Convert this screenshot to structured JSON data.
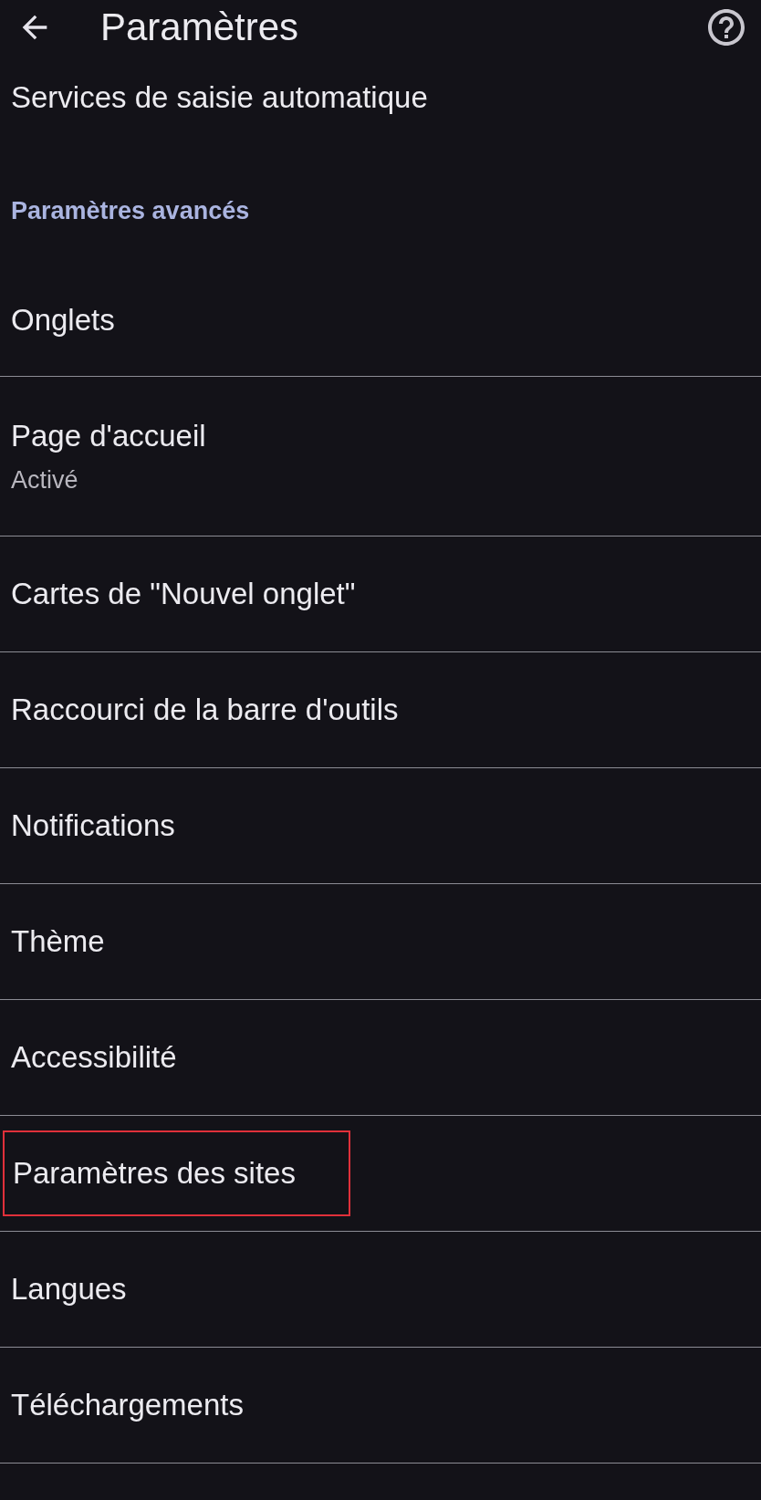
{
  "header": {
    "title": "Paramètres"
  },
  "top_item": {
    "label": "Services de saisie automatique"
  },
  "section": {
    "title": "Paramètres avancés"
  },
  "items": [
    {
      "label": "Onglets",
      "highlighted": false
    },
    {
      "label": "Page d'accueil",
      "subtitle": "Activé",
      "highlighted": false
    },
    {
      "label": "Cartes de \"Nouvel onglet\"",
      "highlighted": false
    },
    {
      "label": "Raccourci de la barre d'outils",
      "highlighted": false
    },
    {
      "label": "Notifications",
      "highlighted": false
    },
    {
      "label": "Thème",
      "highlighted": false
    },
    {
      "label": "Accessibilité",
      "highlighted": false
    },
    {
      "label": "Paramètres des sites",
      "highlighted": true
    },
    {
      "label": "Langues",
      "highlighted": false
    },
    {
      "label": "Téléchargements",
      "highlighted": false
    }
  ]
}
